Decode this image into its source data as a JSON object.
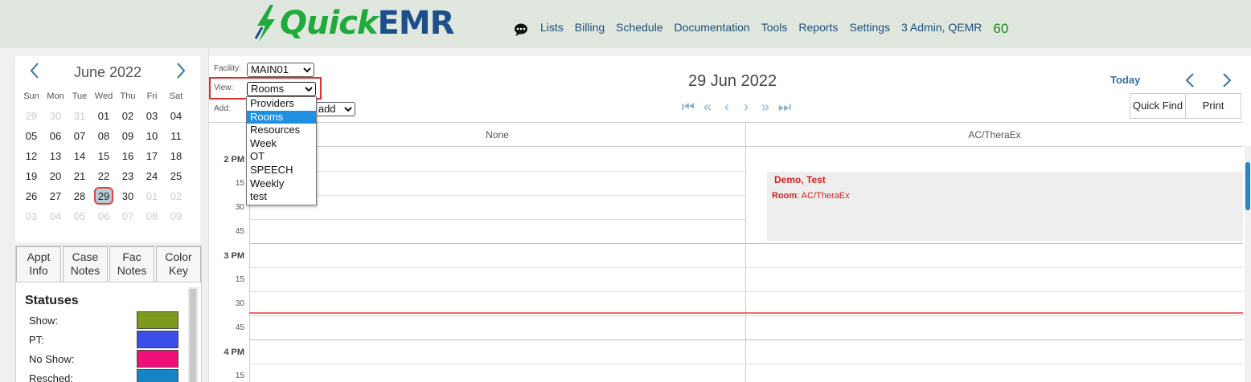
{
  "app": {
    "logo_quick": "Quick",
    "logo_emr": "EMR",
    "nav": [
      "Lists",
      "Billing",
      "Schedule",
      "Documentation",
      "Tools",
      "Reports",
      "Settings",
      "3 Admin, QEMR"
    ],
    "count": "60",
    "colors": {
      "brand_green": "#1faa3b",
      "brand_blue": "#1d4f8a",
      "nav": "#1f4e79"
    }
  },
  "mini_calendar": {
    "title": "June 2022",
    "days_of_week": [
      "Sun",
      "Mon",
      "Tue",
      "Wed",
      "Thu",
      "Fri",
      "Sat"
    ],
    "weeks": [
      [
        "29",
        "30",
        "31",
        "01",
        "02",
        "03",
        "04"
      ],
      [
        "05",
        "06",
        "07",
        "08",
        "09",
        "10",
        "11"
      ],
      [
        "12",
        "13",
        "14",
        "15",
        "16",
        "17",
        "18"
      ],
      [
        "19",
        "20",
        "21",
        "22",
        "23",
        "24",
        "25"
      ],
      [
        "26",
        "27",
        "28",
        "29",
        "30",
        "01",
        "02"
      ],
      [
        "03",
        "04",
        "05",
        "06",
        "07",
        "08",
        "09"
      ]
    ],
    "selected": "29"
  },
  "side_tabs": [
    {
      "label": "Appt\nInfo"
    },
    {
      "label": "Case\nNotes"
    },
    {
      "label": "Fac\nNotes"
    },
    {
      "label": "Color\nKey"
    }
  ],
  "statuses": {
    "title": "Statuses",
    "items": [
      {
        "label": "Show:",
        "color": "#7d9a1c"
      },
      {
        "label": "PT:",
        "color": "#3b4ee8"
      },
      {
        "label": "No Show:",
        "color": "#f0107a"
      },
      {
        "label": "Resched:",
        "color": "#1583c4"
      }
    ]
  },
  "controls": {
    "facility_label": "Facility:",
    "facility_value": "MAIN01",
    "view_label": "View:",
    "view_value": "Rooms",
    "add_label": "Add:",
    "add_value": "o add",
    "view_options": [
      "Providers",
      "Rooms",
      "Resources",
      "Week",
      "OT",
      "SPEECH",
      "Weekly",
      "test"
    ],
    "view_selected_index": 1
  },
  "header": {
    "date": "29 Jun 2022",
    "today": "Today",
    "quick_find": "Quick Find",
    "print": "Print"
  },
  "schedule": {
    "columns": [
      "None",
      "AC/TheraEx"
    ],
    "time_labels": [
      "2 PM",
      "15",
      "30",
      "45",
      "3 PM",
      "15",
      "30",
      "45",
      "4 PM",
      "15"
    ],
    "appointment": {
      "name": "Demo, Test",
      "room_label": "Room",
      "room_value": ": AC/TheraEx"
    }
  }
}
